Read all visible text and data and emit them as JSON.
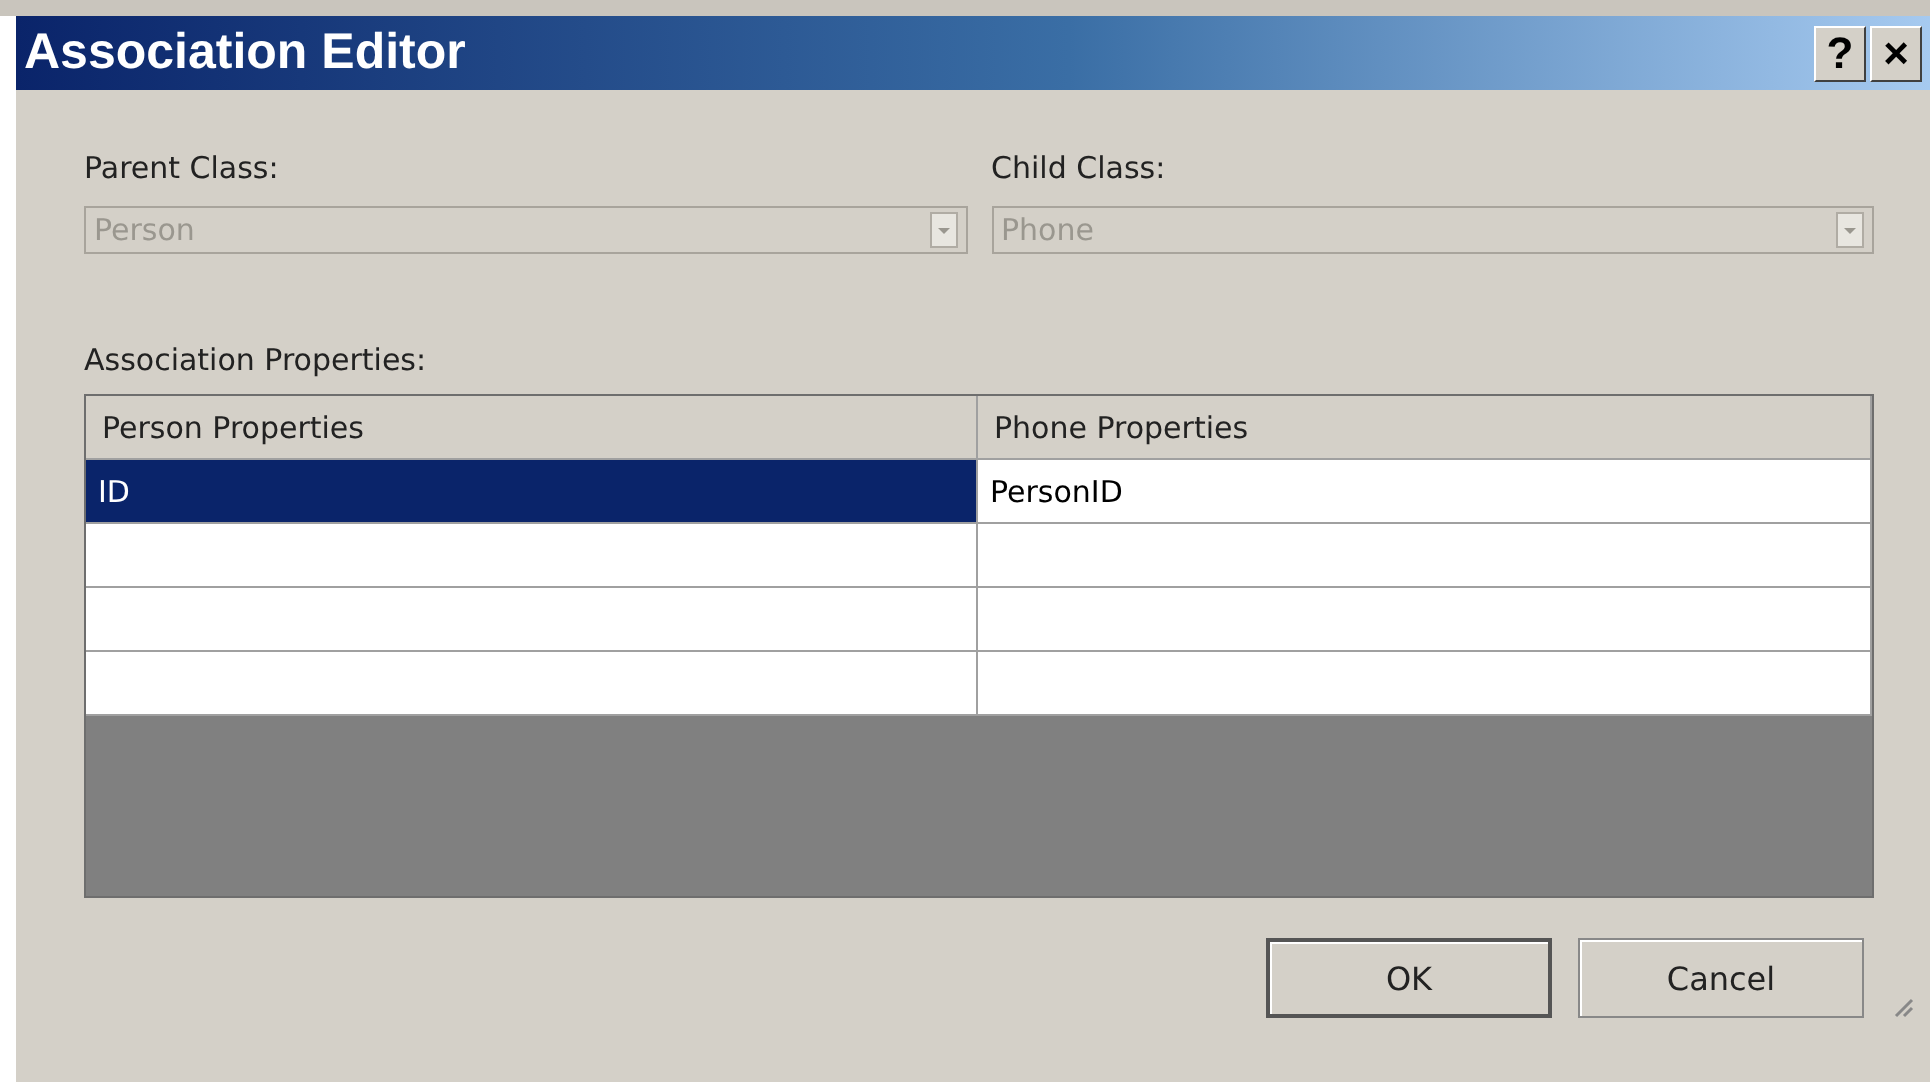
{
  "window": {
    "title": "Association Editor",
    "buttons": [
      "?",
      "×"
    ]
  },
  "parent_class": {
    "label": "Parent Class:",
    "value": "Person",
    "disabled": true
  },
  "child_class": {
    "label": "Child Class:",
    "value": "Phone",
    "disabled": true
  },
  "properties": {
    "label": "Association Properties:",
    "columns": [
      "Person Properties",
      "Phone Properties"
    ],
    "rows": [
      {
        "cells": [
          "ID",
          "PersonID"
        ],
        "selected": true
      },
      {
        "selected": false
      },
      {
        "selected": false
      },
      {
        "selected": false
      }
    ]
  },
  "buttons": [
    {
      "label": "OK",
      "default": true
    },
    {
      "label": "Cancel",
      "default": false
    }
  ]
}
